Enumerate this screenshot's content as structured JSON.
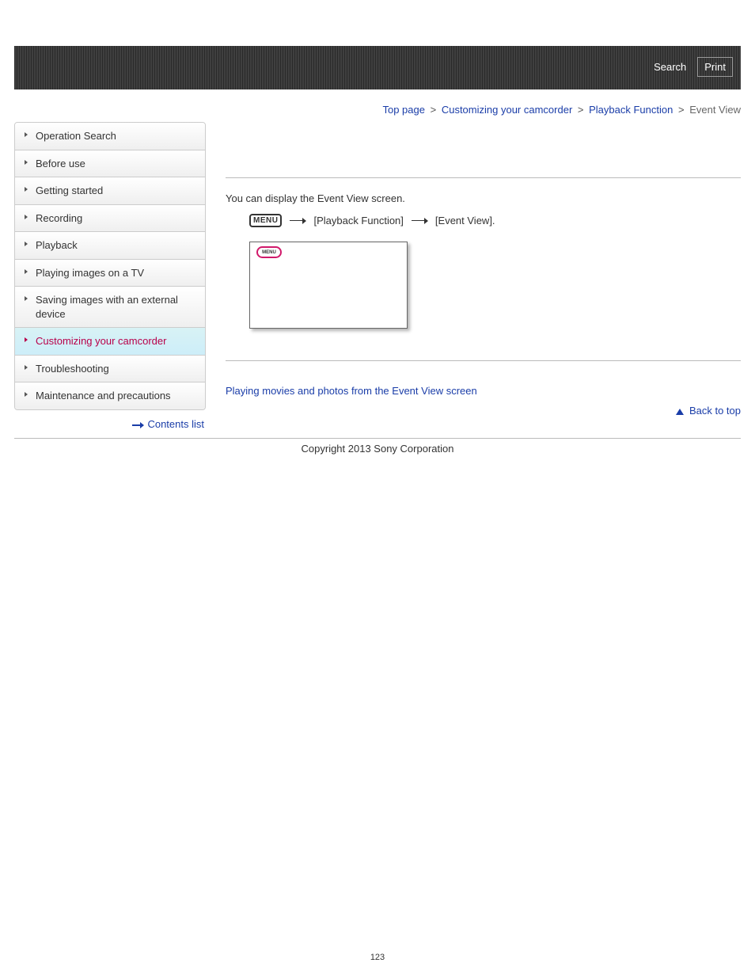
{
  "header": {
    "search_label": "Search",
    "print_label": "Print"
  },
  "breadcrumb": {
    "top_page": "Top page",
    "customizing": "Customizing your camcorder",
    "playback_function": "Playback Function",
    "current": "Event View"
  },
  "sidebar": {
    "items": [
      {
        "label": "Operation Search"
      },
      {
        "label": "Before use"
      },
      {
        "label": "Getting started"
      },
      {
        "label": "Recording"
      },
      {
        "label": "Playback"
      },
      {
        "label": "Playing images on a TV"
      },
      {
        "label": "Saving images with an external device"
      },
      {
        "label": "Customizing your camcorder"
      },
      {
        "label": "Troubleshooting"
      },
      {
        "label": "Maintenance and precautions"
      }
    ],
    "contents_list_label": "Contents list"
  },
  "main": {
    "intro": "You can display the Event View screen.",
    "menu_badge": "MENU",
    "step_a": "[Playback Function]",
    "step_b": "[Event View].",
    "screen_badge_text": "MENU",
    "related_link": "Playing movies and photos from the Event View screen",
    "back_to_top": "Back to top"
  },
  "footer": {
    "copyright": "Copyright 2013 Sony Corporation",
    "page_number": "123"
  }
}
